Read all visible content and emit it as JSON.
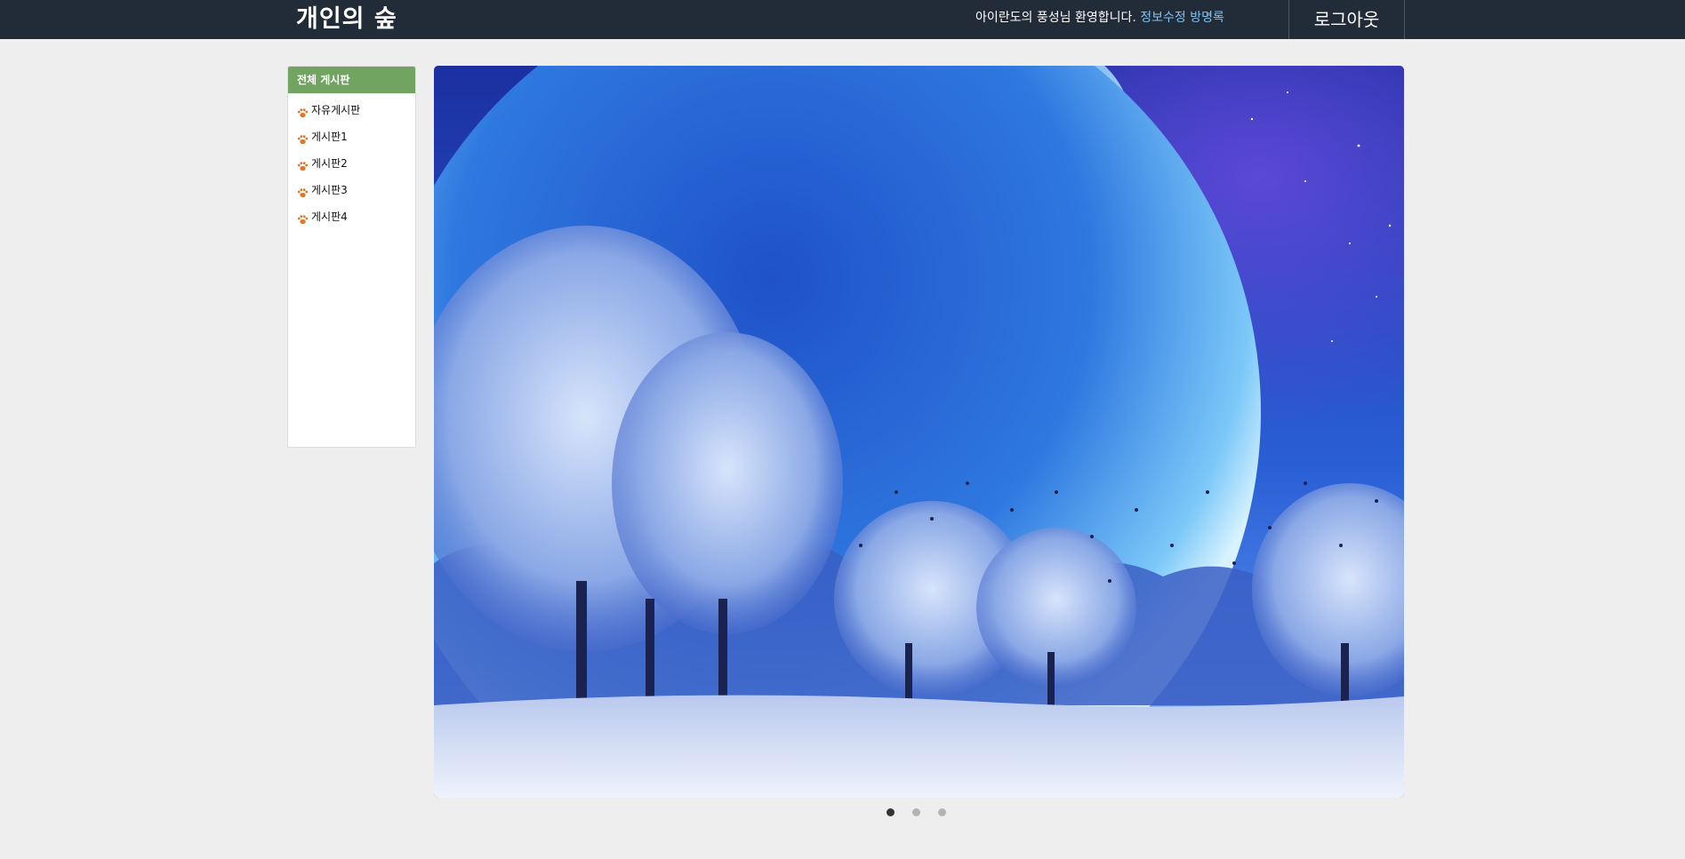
{
  "navbar": {
    "brand": "개인의 숲",
    "welcome_text": "아이란도의 풍성님 환영합니다.",
    "edit_profile_link": "정보수정",
    "guestbook_link": "방명록",
    "logout_label": "로그아웃",
    "background_color": "#222b38",
    "link_color": "#7ec3f0"
  },
  "sidebar": {
    "header": "전체 게시판",
    "header_color": "#72a461",
    "item_icon": "paw-icon",
    "items": [
      {
        "label": "자유게시판"
      },
      {
        "label": "게시판1"
      },
      {
        "label": "게시판2"
      },
      {
        "label": "게시판3"
      },
      {
        "label": "게시판4"
      }
    ]
  },
  "carousel": {
    "slide_count": 3,
    "active_index": 0,
    "slide_image": "winter forest under a giant blue planet"
  }
}
